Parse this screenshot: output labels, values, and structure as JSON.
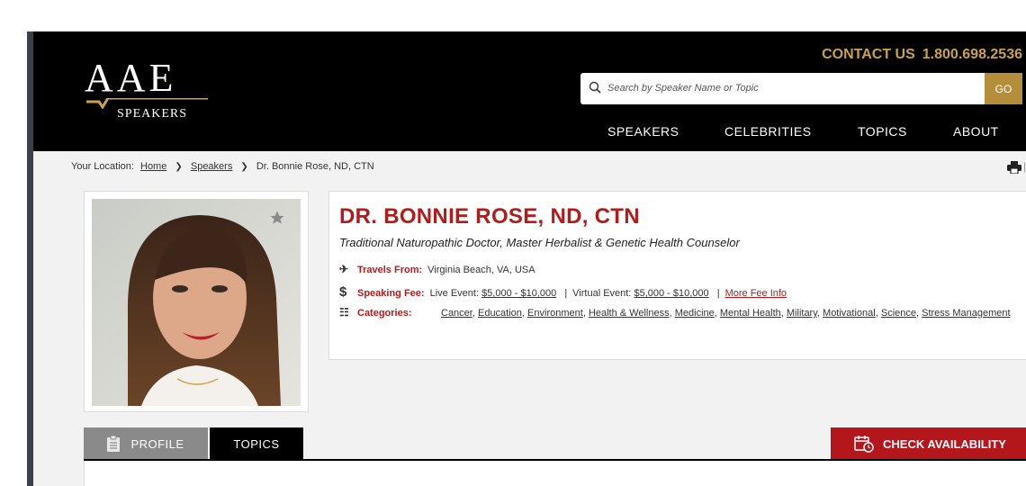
{
  "header": {
    "logo": {
      "main": "AAE",
      "sub": "SPEAKERS"
    },
    "contact": {
      "label": "CONTACT US",
      "phone": "1.800.698.2536"
    },
    "search": {
      "placeholder": "Search by Speaker Name or Topic",
      "value": "",
      "button": "GO"
    },
    "nav": [
      "SPEAKERS",
      "CELEBRITIES",
      "TOPICS",
      "ABOUT"
    ]
  },
  "breadcrumb": {
    "prefix": "Your Location:",
    "items": [
      "Home",
      "Speakers",
      "Dr. Bonnie Rose, ND, CTN"
    ]
  },
  "speaker": {
    "name": "DR. BONNIE ROSE, ND, CTN",
    "title": "Traditional Naturopathic Doctor, Master Herbalist & Genetic Health Counselor",
    "travels": {
      "label": "Travels From:",
      "value": "Virginia Beach, VA, USA"
    },
    "fee": {
      "label": "Speaking Fee:",
      "live_prefix": "Live Event:",
      "live_range": "$5,000 - $10,000",
      "sep": "|",
      "virtual_prefix": "Virtual Event:",
      "virtual_range": "$5,000 - $10,000",
      "more": "More Fee Info"
    },
    "categories": {
      "label": "Categories:",
      "items": [
        "Cancer",
        "Education",
        "Environment",
        "Health & Wellness",
        "Medicine",
        "Mental Health",
        "Military",
        "Motivational",
        "Science",
        "Stress Management"
      ]
    }
  },
  "tabs": {
    "profile": "PROFILE",
    "topics": "TOPICS"
  },
  "cta": {
    "check_availability": "CHECK AVAILABILITY"
  },
  "colors": {
    "gold": "#c9a24a",
    "red": "#b31b1b",
    "black": "#000000"
  }
}
